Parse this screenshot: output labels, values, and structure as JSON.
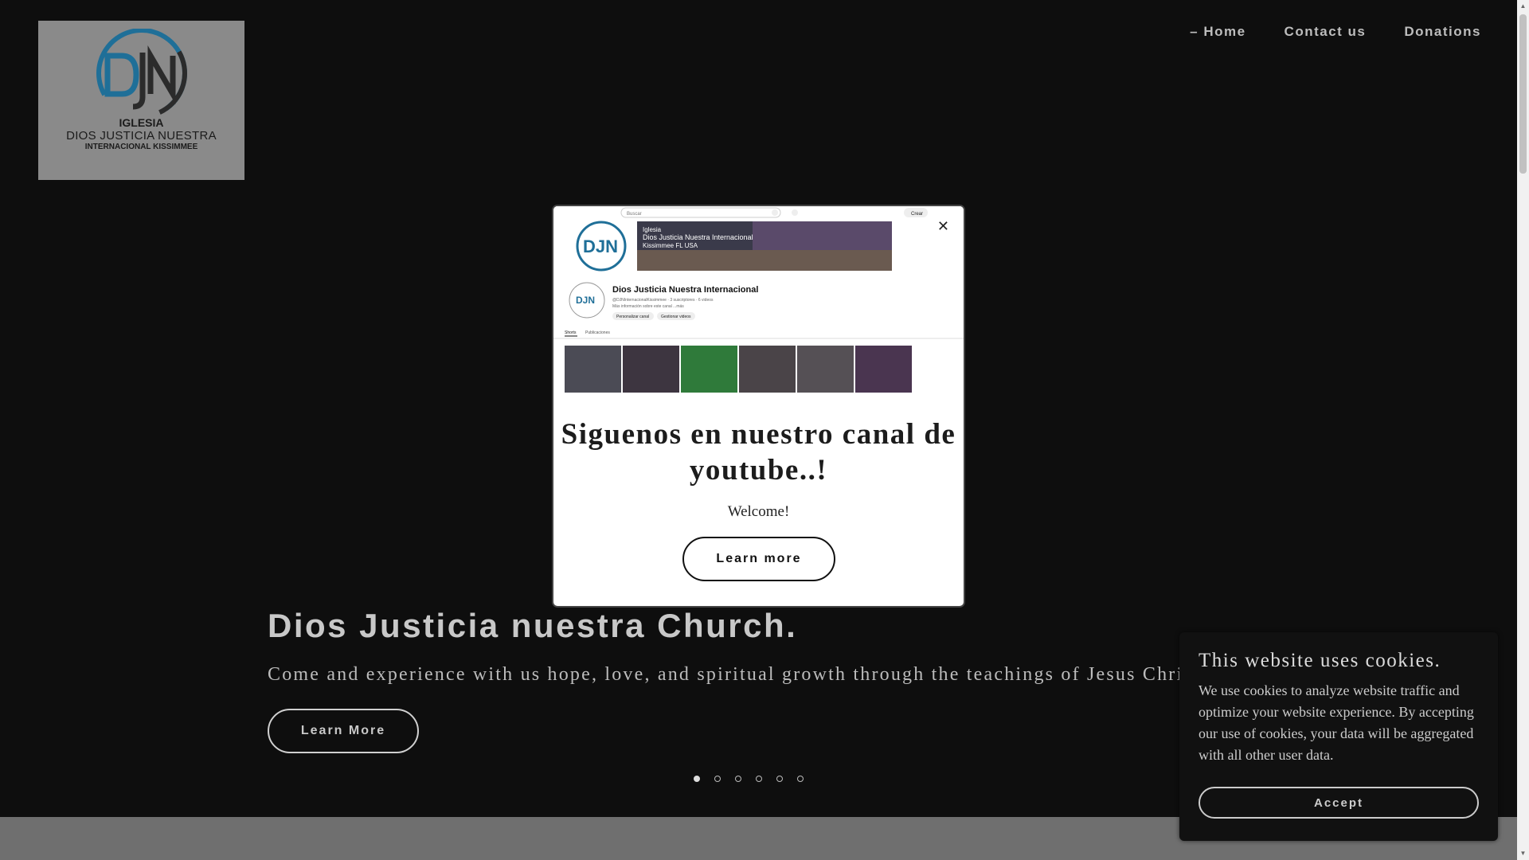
{
  "header": {
    "logo": {
      "line1": "IGLESIA",
      "line2": "DIOS JUSTICIA NUESTRA",
      "line3": "INTERNACIONAL KISSIMMEE",
      "monogram": "DJN"
    },
    "nav": [
      {
        "label": "Home",
        "active": true
      },
      {
        "label": "Contact us",
        "active": false
      },
      {
        "label": "Donations",
        "active": false
      }
    ]
  },
  "hero": {
    "title": "Dios Justicia nuestra Church.",
    "subtitle": "Come and experience with us hope, love, and spiritual growth through the teachings of Jesus Christ.",
    "button_label": "Learn More",
    "slides_total": 6,
    "slide_active": 1
  },
  "modal": {
    "image_caption": {
      "search_placeholder": "Buscar",
      "create_label": "Crear",
      "banner_line1": "Iglesia",
      "banner_line2": "Dios Justicia Nuestra Internacional",
      "banner_line3": "Kissimmee FL USA",
      "channel_name": "Dios Justicia Nuestra Internacional",
      "channel_handle": "@DJNInternacionalKissimmee · 3 suscriptores · 6 videos",
      "channel_more": "Más información sobre este canal ...más",
      "btn_customize": "Personalizar canal",
      "btn_manage": "Gestionar videos",
      "tab_shorts": "Shorts",
      "tab_posts": "Publicaciones"
    },
    "title": "Siguenos en nuestro canal de youtube..!",
    "text": "Welcome!",
    "button_label": "Learn more",
    "close_icon": "close-icon"
  },
  "cookie": {
    "title": "This website uses cookies.",
    "text": "We use cookies to analyze website traffic and optimize your website experience. By accepting our use of cookies, your data will be aggregated with all other user data.",
    "accept_label": "Accept"
  },
  "colors": {
    "background": "#0e0e0e",
    "logo_blue": "#1f6f98",
    "modal_bg": "#ffffff"
  }
}
